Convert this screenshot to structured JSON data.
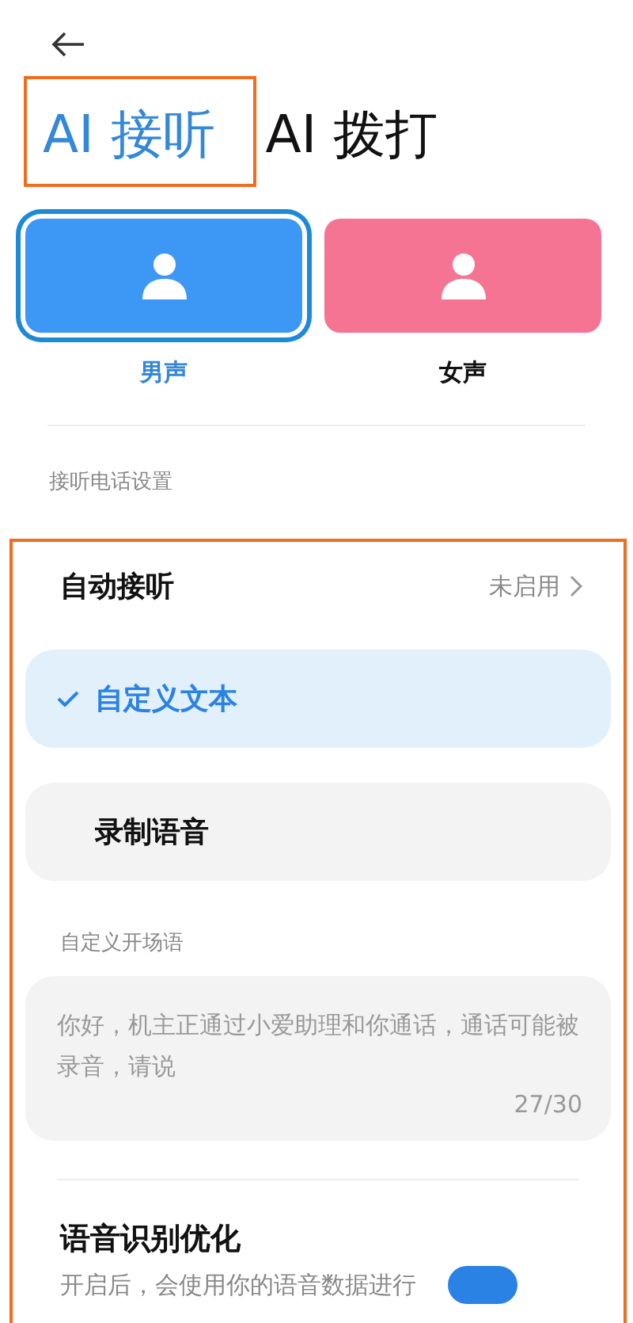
{
  "tabs": [
    {
      "label": "AI 接听",
      "selected": true
    },
    {
      "label": "AI 拨打",
      "selected": false
    }
  ],
  "voices": [
    {
      "label": "男声",
      "selected": true,
      "color": "#3d97f5"
    },
    {
      "label": "女声",
      "selected": false,
      "color": "#f57494"
    }
  ],
  "section_label": "接听电话设置",
  "auto_answer": {
    "label": "自动接听",
    "value": "未启用"
  },
  "options": [
    {
      "label": "自定义文本",
      "selected": true
    },
    {
      "label": "录制语音",
      "selected": false
    }
  ],
  "greeting": {
    "label": "自定义开场语",
    "value": "你好，机主正通过小爱助理和你通话，通话可能被录音，请说",
    "count": "27/30"
  },
  "speech_optimization": {
    "title": "语音识别优化",
    "description": "开启后，会使用你的语音数据进行",
    "on": true
  }
}
